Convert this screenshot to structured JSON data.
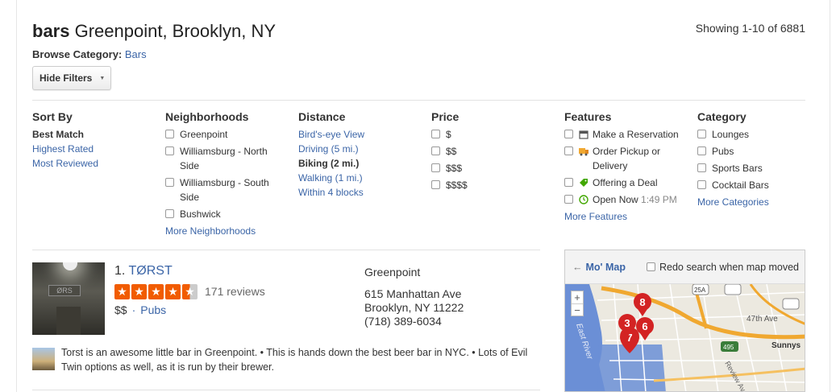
{
  "header": {
    "query": "bars",
    "location": "Greenpoint, Brooklyn, NY",
    "showing": "Showing 1-10 of 6881",
    "browse_label": "Browse Category:",
    "browse_value": "Bars",
    "hide_filters": "Hide Filters"
  },
  "filters": {
    "sort_by": {
      "title": "Sort By",
      "items": [
        "Best Match",
        "Highest Rated",
        "Most Reviewed"
      ],
      "selected": "Best Match"
    },
    "neighborhoods": {
      "title": "Neighborhoods",
      "items": [
        "Greenpoint",
        "Williamsburg - North Side",
        "Williamsburg - South Side",
        "Bushwick"
      ],
      "more": "More Neighborhoods"
    },
    "distance": {
      "title": "Distance",
      "items": [
        "Bird's-eye View",
        "Driving (5 mi.)",
        "Biking (2 mi.)",
        "Walking (1 mi.)",
        "Within 4 blocks"
      ],
      "selected": "Biking (2 mi.)"
    },
    "price": {
      "title": "Price",
      "items": [
        "$",
        "$$",
        "$$$",
        "$$$$"
      ]
    },
    "features": {
      "title": "Features",
      "items": [
        "Make a Reservation",
        "Order Pickup or Delivery",
        "Offering a Deal",
        "Open Now"
      ],
      "open_time": "1:49 PM",
      "icons": [
        "calendar-icon",
        "delivery-truck-icon",
        "tag-icon",
        "clock-icon"
      ],
      "more": "More Features"
    },
    "category": {
      "title": "Category",
      "items": [
        "Lounges",
        "Pubs",
        "Sports Bars",
        "Cocktail Bars"
      ],
      "more": "More Categories"
    }
  },
  "result": {
    "index": "1.",
    "name": "TØRST",
    "rating": 4.5,
    "reviews": "171 reviews",
    "price": "$$",
    "category": "Pubs",
    "neighborhood": "Greenpoint",
    "address1": "615 Manhattan Ave",
    "address2": "Brooklyn, NY 11222",
    "phone": "(718) 389-6034",
    "image_sign": "ØRS",
    "snippet": "Torst is an awesome little bar in Greenpoint.  •  This is hands down the best beer bar in NYC.  •  Lots of Evil Twin options as well, as it is run by their brewer."
  },
  "map": {
    "title": "Mo' Map",
    "redo": "Redo search when map moved",
    "zoom_in": "+",
    "zoom_out": "−",
    "labels": [
      "East River",
      "47th Ave",
      "Sunnys",
      "Review Av",
      "25A",
      "495"
    ],
    "markers": [
      "8",
      "3",
      "6",
      "7"
    ],
    "colors": {
      "water": "#6b8fd6",
      "highway": "#f0a830",
      "marker": "#d32323"
    }
  }
}
